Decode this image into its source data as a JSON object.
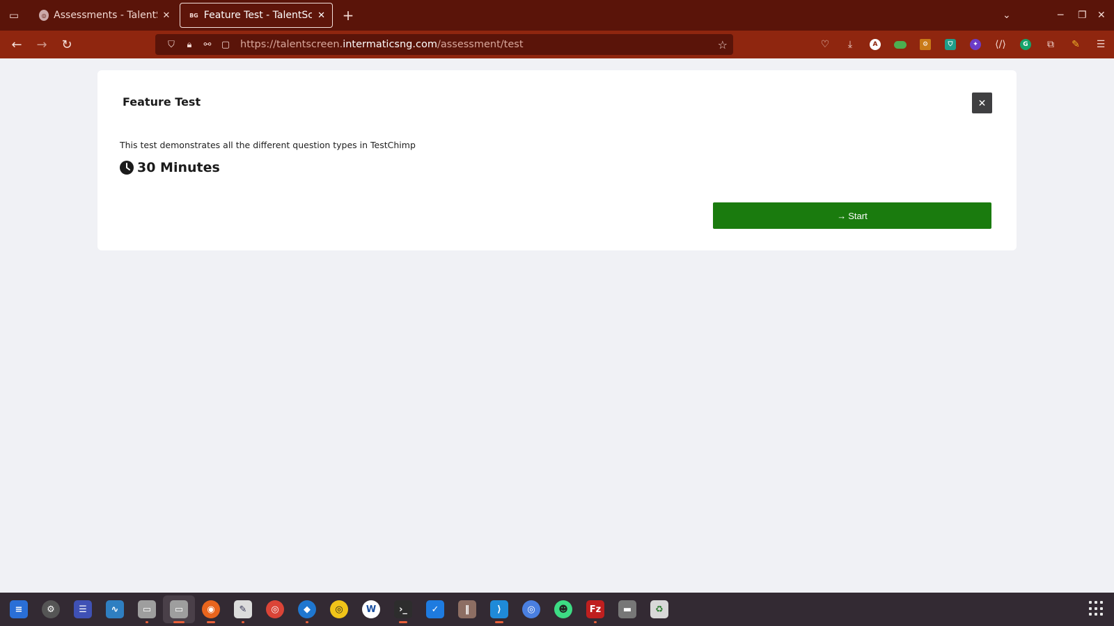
{
  "browser": {
    "tabs": [
      {
        "title": "Assessments - TalentScreen",
        "favicon": "S"
      },
      {
        "title": "Feature Test - TalentScreen",
        "favicon": "BG"
      }
    ],
    "url": {
      "scheme": "https://talentscreen.",
      "host": "intermaticsng.com",
      "path": "/assessment/test"
    },
    "extensions": [
      "pocket-icon",
      "download-icon",
      "A",
      "toggle-icon",
      "gear-icon",
      "shield-icon",
      "puzzle-color-icon",
      "code-icon",
      "G",
      "extensions-icon",
      "pen-icon",
      "menu-icon"
    ],
    "colors": {
      "tab_bar": "#5a1409",
      "nav_bar": "#8f260f"
    }
  },
  "page": {
    "title": "Feature Test",
    "close_label": "✕",
    "description": "This test demonstrates all the different question types in TestChimp",
    "duration": "30 Minutes",
    "start_label": "Start",
    "start_color": "#1a7b0e"
  },
  "taskbar": {
    "apps": [
      "docs-icon",
      "settings-icon",
      "writer-icon",
      "monitor-icon",
      "files-icon",
      "files-active-icon",
      "firefox-icon",
      "text-editor-icon",
      "chrome-icon",
      "thunderbird-icon",
      "rhythmbox-icon",
      "wps-icon",
      "terminal-icon",
      "tasks-icon",
      "library-icon",
      "vscode-icon",
      "chromium-icon",
      "android-icon",
      "filezilla-icon",
      "drive-icon",
      "trash-icon"
    ]
  }
}
